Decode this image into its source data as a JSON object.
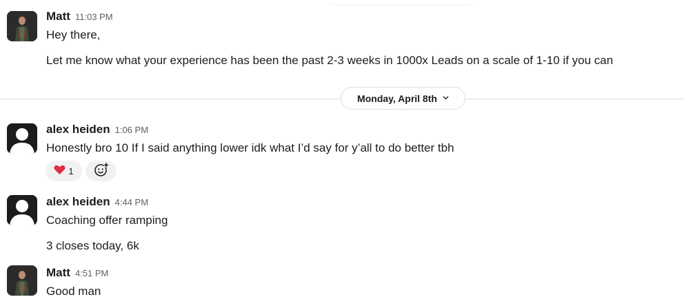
{
  "messages": [
    {
      "sender": "Matt",
      "time": "11:03 PM",
      "lines": [
        "Hey there,",
        "Let me know what your experience has been the past 2-3 weeks in 1000x Leads on a scale of 1-10 if you can"
      ]
    },
    {
      "sender": "alex heiden",
      "time": "1:06 PM",
      "lines": [
        "Honestly bro 10 If I said anything lower idk what I’d say for y’all to do better tbh"
      ],
      "reaction": {
        "emoji": "❤️",
        "count": "1"
      }
    },
    {
      "sender": "alex heiden",
      "time": "4:44 PM",
      "lines": [
        "Coaching offer ramping",
        "3 closes today, 6k"
      ]
    },
    {
      "sender": "Matt",
      "time": "4:51 PM",
      "lines": [
        "Good man"
      ]
    }
  ],
  "date_divider": {
    "label": "Monday, April 8th"
  },
  "icons": {
    "chevron": "chevron-down-icon",
    "add_reaction": "add-reaction-icon",
    "heart": "heart-emoji"
  },
  "colors": {
    "text": "#1d1c1d",
    "timestamp": "#616061",
    "heart": "#dd2e44",
    "reaction_bg": "#f1f1f1"
  }
}
